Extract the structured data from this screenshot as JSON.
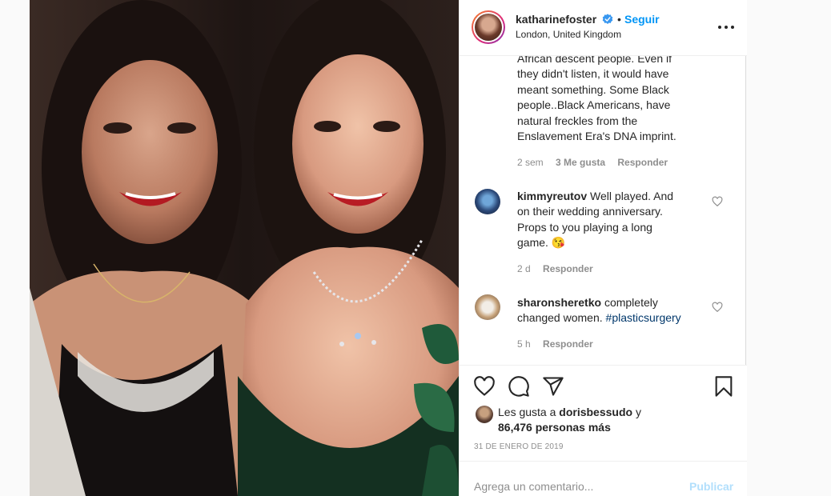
{
  "post": {
    "username": "katharinefoster",
    "separator": "•",
    "follow_label": "Seguir",
    "location": "London, United Kingdom"
  },
  "comments": [
    {
      "text_lines": [
        "African descent people. Even if",
        "they didn't listen, it would have",
        "meant something. Some Black",
        "people..Black Americans, have",
        "natural freckles from the",
        "Enslavement Era's DNA imprint."
      ],
      "time": "2 sem",
      "likes": "3 Me gusta",
      "reply": "Responder"
    },
    {
      "username": "kimmyreutov",
      "text_lines": [
        "Well played. And",
        "on their wedding anniversary.",
        "Props to you playing a long",
        "game. 😘"
      ],
      "time": "2 d",
      "reply": "Responder"
    },
    {
      "username": "sharonsheretko",
      "text_lines": [
        "completely",
        "changed women."
      ],
      "hashtag": "#plasticsurgery",
      "time": "5 h",
      "reply": "Responder"
    }
  ],
  "likes": {
    "prefix": "Les gusta a",
    "user": "dorisbessudo",
    "suffix": "y",
    "others": "86,476 personas más"
  },
  "date": "31 DE ENERO DE 2019",
  "add_comment": {
    "placeholder": "Agrega un comentario...",
    "publish": "Publicar"
  },
  "icons": {
    "verified": "verified-badge-icon",
    "more": "more-options-icon",
    "like": "heart-icon",
    "comment": "comment-icon",
    "share": "share-icon",
    "save": "bookmark-icon"
  },
  "colors": {
    "link": "#0095f6",
    "verified": "#3897f0",
    "publish_disabled": "#b2dffc",
    "secondary_text": "#8e8e8e"
  }
}
